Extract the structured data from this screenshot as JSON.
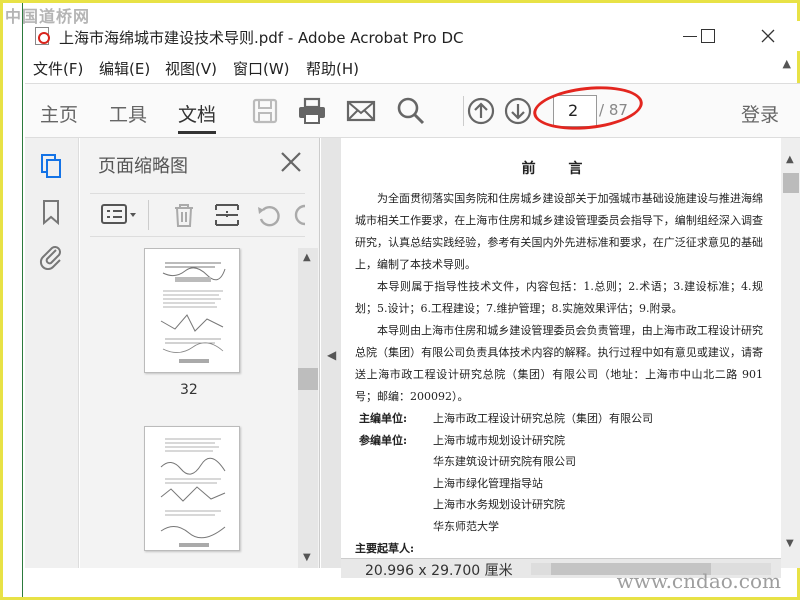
{
  "watermarks": {
    "top": "中国道桥网",
    "bottom": "www.cndao.com"
  },
  "window": {
    "title": "上海市海绵城市建设技术导则.pdf - Adobe Acrobat Pro DC"
  },
  "menu": {
    "items": [
      "文件(F)",
      "编辑(E)",
      "视图(V)",
      "窗口(W)",
      "帮助(H)"
    ]
  },
  "toolbar": {
    "tabs": [
      "主页",
      "工具",
      "文档"
    ],
    "active_tab": "文档",
    "page_current": "2",
    "page_total": "/ 87",
    "login": "登录",
    "annotation_color": "#e3261f"
  },
  "thumbnails": {
    "title": "页面缩略图",
    "pages": [
      "32",
      ""
    ]
  },
  "document": {
    "heading": "前 言",
    "paragraphs": [
      "为全面贯彻落实国务院和住房城乡建设部关于加强城市基础设施建设与推进海绵城市相关工作要求，在上海市住房和城乡建设管理委员会指导下，编制组经深入调查研究，认真总结实践经验，参考有关国内外先进标准和要求，在广泛征求意见的基础上，编制了本技术导则。",
      "本导则属于指导性技术文件，内容包括：1.总则；2.术语；3.建设标准；4.规划；5.设计；6.工程建设；7.维护管理；8.实施效果评估；9.附录。",
      "本导则由上海市住房和城乡建设管理委员会负责管理，由上海市政工程设计研究总院（集团）有限公司负责具体技术内容的解释。执行过程中如有意见或建议，请寄送上海市政工程设计研究总院（集团）有限公司（地址：上海市中山北二路 901 号；邮编：200092）。"
    ],
    "chief_editor_label": "主编单位:",
    "chief_editor": "上海市政工程设计研究总院（集团）有限公司",
    "participants_label": "参编单位:",
    "participants": [
      "上海市城市规划设计研究院",
      "华东建筑设计研究院有限公司",
      "上海市绿化管理指导站",
      "上海市水务规划设计研究院",
      "华东师范大学"
    ],
    "drafters_label": "主要起草人:"
  },
  "status": {
    "page_size": "20.996 x 29.700 厘米"
  }
}
